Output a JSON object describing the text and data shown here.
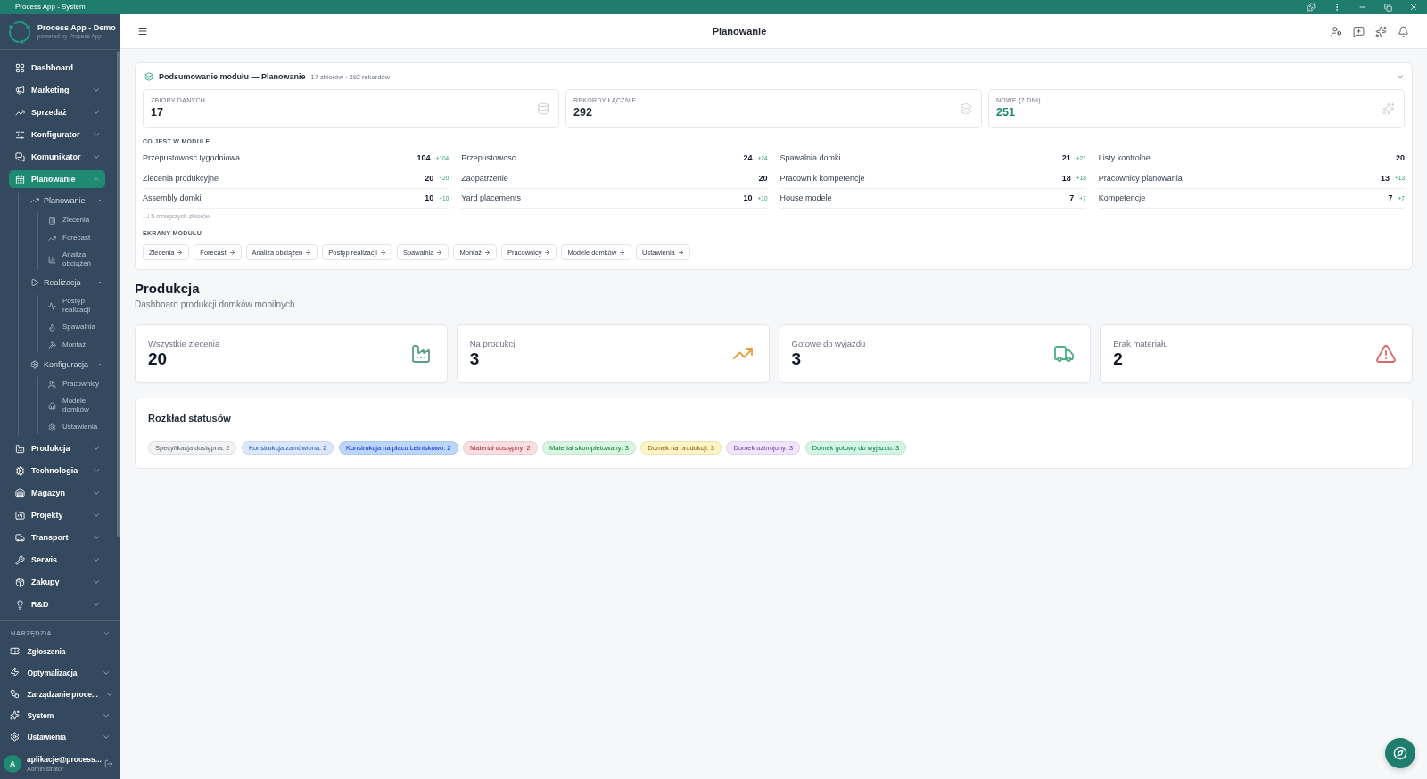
{
  "window": {
    "title": "Process App - System"
  },
  "sidebar": {
    "brand": {
      "name": "Process App - Demo",
      "tagline": "powered by Process App"
    },
    "nav": [
      {
        "label": "Dashboard",
        "kind": "link",
        "selected": false
      },
      {
        "label": "Marketing",
        "kind": "group",
        "expanded": false,
        "selected": false
      },
      {
        "label": "Sprzedaż",
        "kind": "group",
        "expanded": false,
        "selected": false
      },
      {
        "label": "Konfigurator",
        "kind": "group",
        "expanded": false,
        "selected": false
      },
      {
        "label": "Komunikator",
        "kind": "group",
        "expanded": false,
        "selected": false
      },
      {
        "label": "Planowanie",
        "kind": "group",
        "expanded": true,
        "selected": true,
        "children": [
          {
            "label": "Planowanie",
            "kind": "group",
            "expanded": true,
            "selected": false,
            "children": [
              {
                "label": "Zlecenia",
                "kind": "link",
                "selected": false
              },
              {
                "label": "Forecast",
                "kind": "link",
                "selected": false
              },
              {
                "label": "Analiza obciążeń",
                "kind": "link",
                "selected": false
              }
            ]
          },
          {
            "label": "Realizacja",
            "kind": "group",
            "expanded": true,
            "selected": false,
            "children": [
              {
                "label": "Postęp realizacji",
                "kind": "link",
                "selected": false
              },
              {
                "label": "Spawalnia",
                "kind": "link",
                "selected": false
              },
              {
                "label": "Montaż",
                "kind": "link",
                "selected": false
              }
            ]
          },
          {
            "label": "Konfiguracja",
            "kind": "group",
            "expanded": true,
            "selected": false,
            "children": [
              {
                "label": "Pracownicy",
                "kind": "link",
                "selected": false
              },
              {
                "label": "Modele domków",
                "kind": "link",
                "selected": false
              },
              {
                "label": "Ustawienia",
                "kind": "link",
                "selected": false
              }
            ]
          }
        ]
      },
      {
        "label": "Produkcja",
        "kind": "group",
        "expanded": false,
        "selected": false
      },
      {
        "label": "Technologia",
        "kind": "group",
        "expanded": false,
        "selected": false
      },
      {
        "label": "Magazyn",
        "kind": "group",
        "expanded": false,
        "selected": false
      },
      {
        "label": "Projekty",
        "kind": "group",
        "expanded": false,
        "selected": false
      },
      {
        "label": "Transport",
        "kind": "group",
        "expanded": false,
        "selected": false
      },
      {
        "label": "Serwis",
        "kind": "group",
        "expanded": false,
        "selected": false
      },
      {
        "label": "Zakupy",
        "kind": "group",
        "expanded": false,
        "selected": false
      },
      {
        "label": "R&D",
        "kind": "group",
        "expanded": false,
        "selected": false
      }
    ],
    "tools": {
      "heading": "NARZĘDZIA",
      "items": [
        {
          "label": "Zgłoszenia",
          "kind": "link",
          "selected": false
        },
        {
          "label": "Optymalizacja",
          "kind": "group",
          "expanded": false,
          "selected": false
        },
        {
          "label": "Zarządzanie proce...",
          "kind": "group",
          "expanded": false,
          "selected": false
        },
        {
          "label": "System",
          "kind": "group",
          "expanded": false,
          "selected": false
        },
        {
          "label": "Ustawienia",
          "kind": "group",
          "expanded": false,
          "selected": false
        }
      ]
    },
    "user": {
      "initial": "A",
      "name": "aplikacje@process...",
      "role": "Administrator"
    }
  },
  "header": {
    "title": "Planowanie"
  },
  "module_summary": {
    "title": "Podsumowanie modułu — Planowanie",
    "meta": "17 zbiorów · 292 rekordów",
    "stats": [
      {
        "label": "ZBIORY DANYCH",
        "value": "17",
        "kind": "count"
      },
      {
        "label": "REKORDY ŁĄCZNIE",
        "value": "292",
        "kind": "count"
      },
      {
        "label": "NOWE (7 DNI)",
        "value": "251",
        "kind": "new"
      }
    ],
    "contents_heading": "CO JEST W MODULE",
    "datasets": [
      {
        "name": "Przepustowosc tygodniowa",
        "count": "104",
        "delta": "+104"
      },
      {
        "name": "Przepustowosc",
        "count": "24",
        "delta": "+24"
      },
      {
        "name": "Spawalnia domki",
        "count": "21",
        "delta": "+21"
      },
      {
        "name": "Listy kontrolne",
        "count": "20"
      },
      {
        "name": "Zlecenia produkcyjne",
        "count": "20",
        "delta": "+20"
      },
      {
        "name": "Zaopatrzenie",
        "count": "20"
      },
      {
        "name": "Pracownik kompetencje",
        "count": "18",
        "delta": "+18"
      },
      {
        "name": "Pracownicy planowania",
        "count": "13",
        "delta": "+13"
      },
      {
        "name": "Assembly domki",
        "count": "10",
        "delta": "+10"
      },
      {
        "name": "Yard placements",
        "count": "10",
        "delta": "+10"
      },
      {
        "name": "House modele",
        "count": "7",
        "delta": "+7"
      },
      {
        "name": "Kompetencje",
        "count": "7",
        "delta": "+7"
      }
    ],
    "more": "...i 5 mniejszych zbiorów",
    "screens_heading": "EKRANY MODUŁU",
    "screens": [
      "Zlecenia",
      "Forecast",
      "Analiza obciążeń",
      "Postęp realizacji",
      "Spawalnia",
      "Montaż",
      "Pracownicy",
      "Modele domków",
      "Ustawienia"
    ]
  },
  "dashboard": {
    "title": "Produkcja",
    "subtitle": "Dashboard produkcji domków mobilnych",
    "kpis": [
      {
        "label": "Wszystkie zlecenia",
        "value": "20",
        "color": "#5a9e89"
      },
      {
        "label": "Na produkcji",
        "value": "3",
        "color": "#e0a33c"
      },
      {
        "label": "Gotowe do wyjazdu",
        "value": "3",
        "color": "#4fae82"
      },
      {
        "label": "Brak materiału",
        "value": "2",
        "color": "#e06666"
      }
    ],
    "status_distribution": {
      "title": "Rozkład statusów",
      "statuses": [
        {
          "label": "Specyfikacja dostępna: 2",
          "color": "#f1f2f4"
        },
        {
          "label": "Konstrukcja zamówiona: 2",
          "color": "#dbe7fc"
        },
        {
          "label": "Konstrukcja na placu Letniskowo: 2",
          "color": "#bcd5fa"
        },
        {
          "label": "Materiał dostępny: 2",
          "color": "#fbdfe0"
        },
        {
          "label": "Materiał skompletowany: 3",
          "color": "#d9f6e3"
        },
        {
          "label": "Domek na produkcji: 3",
          "color": "#fdf5c4"
        },
        {
          "label": "Domek uzbrojony: 3",
          "color": "#efe5fd"
        },
        {
          "label": "Domek gotowy do wyjazdu: 3",
          "color": "#d2f5e6"
        }
      ]
    }
  }
}
